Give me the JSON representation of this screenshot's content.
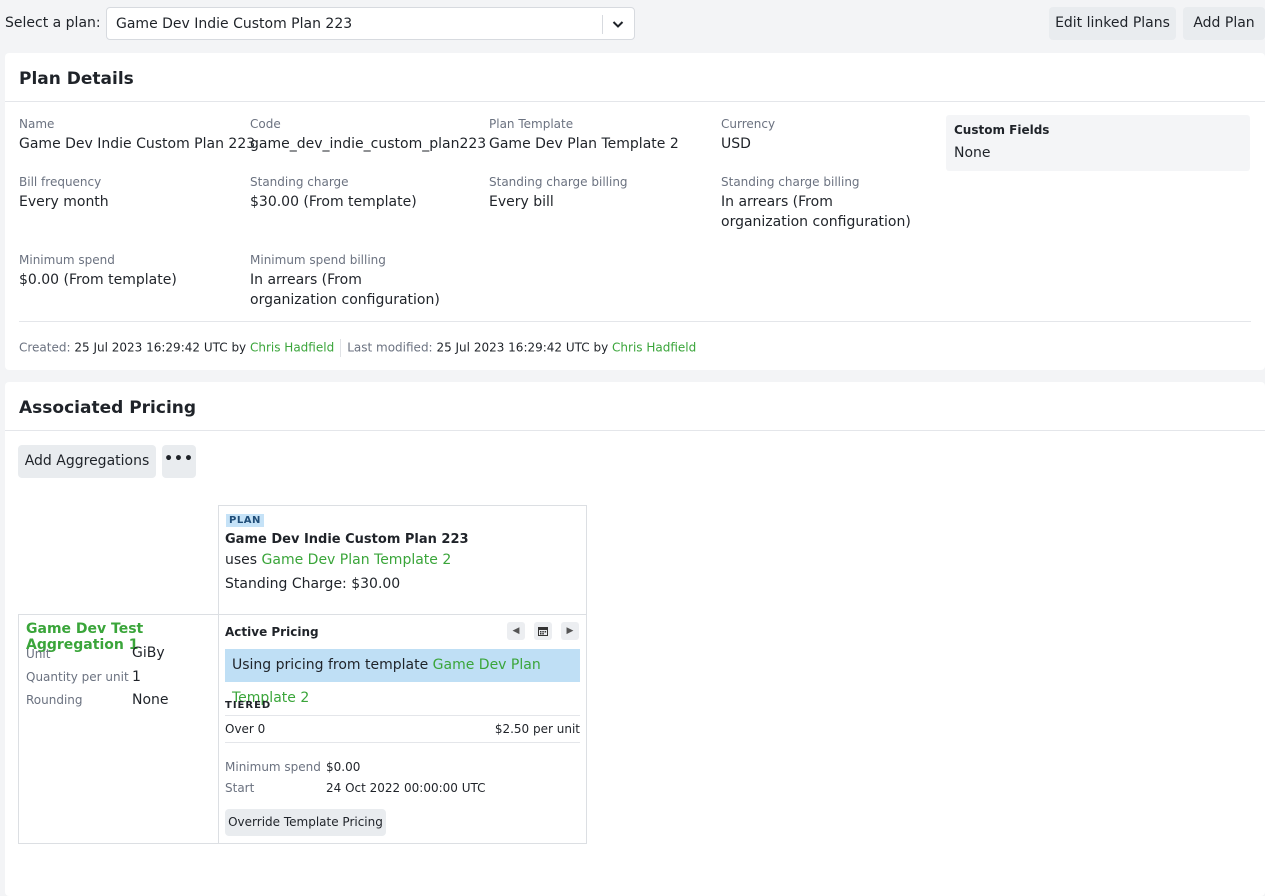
{
  "topbar": {
    "select_label": "Select a plan:",
    "selected_plan": "Game Dev Indie Custom Plan 223",
    "edit_linked_label": "Edit linked Plans",
    "add_plan_label": "Add Plan"
  },
  "plan_details": {
    "title": "Plan Details",
    "fields": [
      {
        "label": "Name",
        "value": "Game Dev Indie Custom Plan 223"
      },
      {
        "label": "Code",
        "value": "game_dev_indie_custom_plan223"
      },
      {
        "label": "Plan Template",
        "value": "Game Dev Plan Template 2"
      },
      {
        "label": "Currency",
        "value": "USD"
      },
      {
        "label": "Bill frequency",
        "value": "Every month"
      },
      {
        "label": "Standing charge",
        "value": "$30.00 (From template)"
      },
      {
        "label": "Standing charge billing",
        "value": "Every bill"
      },
      {
        "label": "Standing charge billing",
        "value": "In arrears (From organization configuration)"
      },
      {
        "label": "Minimum spend",
        "value": "$0.00 (From template)"
      },
      {
        "label": "Minimum spend billing",
        "value": "In arrears (From organization configuration)"
      }
    ],
    "custom_fields": {
      "title": "Custom Fields",
      "value": "None"
    },
    "meta": {
      "created_label": "Created:",
      "created_value": "25 Jul 2023 16:29:42 UTC",
      "by": "by",
      "created_by": "Chris Hadfield",
      "modified_label": "Last modified:",
      "modified_value": "25 Jul 2023 16:29:42 UTC",
      "modified_by": "Chris Hadfield"
    }
  },
  "pricing": {
    "title": "Associated Pricing",
    "add_aggregations_label": "Add Aggregations",
    "more_label": "•••",
    "plan": {
      "badge": "PLAN",
      "name": "Game Dev Indie Custom Plan 223",
      "uses_prefix": "uses",
      "uses_template": "Game Dev Plan Template 2",
      "standing_charge": "Standing Charge: $30.00"
    },
    "aggregation": {
      "name": "Game Dev Test Aggregation 1",
      "rows": [
        {
          "label": "Unit",
          "value": "GiBy"
        },
        {
          "label": "Quantity per unit",
          "value": "1"
        },
        {
          "label": "Rounding",
          "value": "None"
        }
      ]
    },
    "active": {
      "title": "Active Pricing",
      "using_prefix": "Using pricing from template",
      "using_template": "Game Dev Plan Template 2",
      "tiered_label": "TIERED",
      "tier_range": "Over 0",
      "tier_price": "$2.50 per unit",
      "min_spend_label": "Minimum spend",
      "min_spend_value": "$0.00",
      "start_label": "Start",
      "start_value": "24 Oct 2022 00:00:00 UTC",
      "override_label": "Override Template Pricing"
    }
  }
}
